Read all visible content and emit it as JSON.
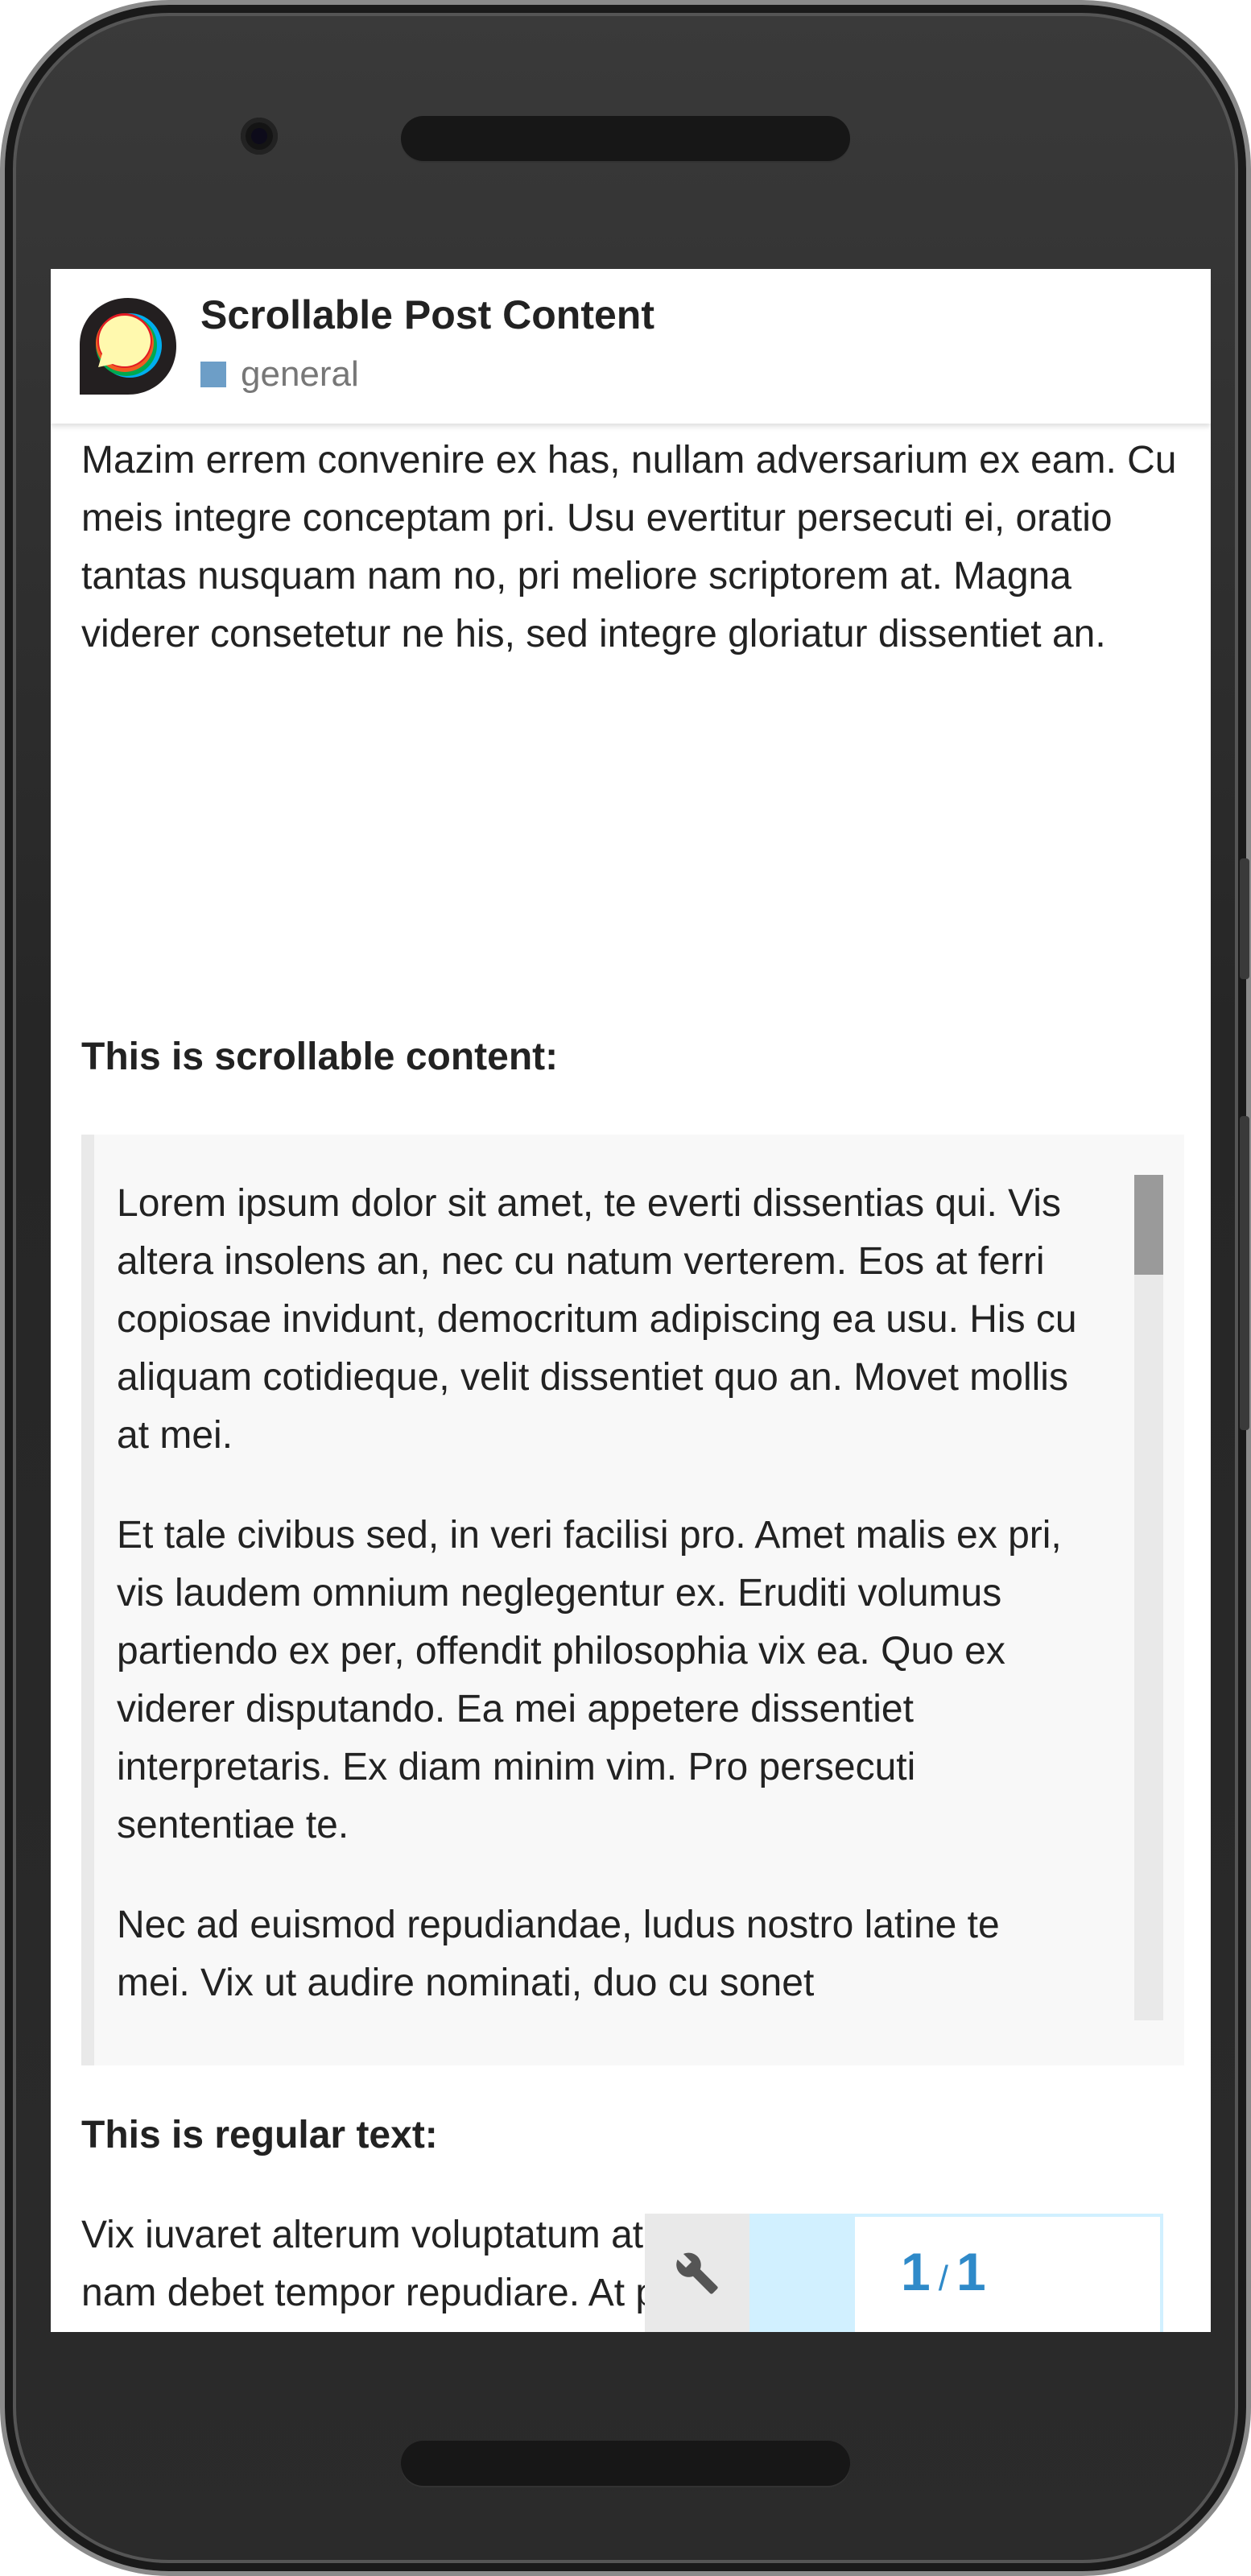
{
  "header": {
    "title": "Scrollable Post Content",
    "category": "general",
    "category_color": "#6d9ec7"
  },
  "post": {
    "intro": "Mazim errem convenire ex has, nullam adversarium ex eam. Cu meis integre conceptam pri. Usu evertitur persecuti ei, oratio tantas nusquam nam no, pri meliore scriptorem at. Magna viderer consetetur ne his, sed integre gloriatur dissentiet an.",
    "scrollable_heading": "This is scrollable content:",
    "scrollable_paragraphs": [
      "Lorem ipsum dolor sit amet, te everti dissentias qui. Vis altera insolens an, nec cu natum verterem. Eos at ferri copiosae invidunt, democritum adipiscing ea usu. His cu aliquam cotidieque, velit dissentiet quo an. Movet mollis at mei.",
      "Et tale civibus sed, in veri facilisi pro. Amet malis ex pri, vis laudem omnium neglegentur ex. Eruditi volumus partiendo ex per, offendit philosophia vix ea. Quo ex viderer disputando. Ea mei appetere dissentiet interpretaris. Ex diam minim vim. Pro persecuti sententiae te.",
      "Nec ad euismod repudiandae, ludus nostro latine te mei. Vix ut audire nominati, duo cu sonet"
    ],
    "regular_heading": "This is regular text:",
    "regular_text": "Vix iuvaret alterum voluptatum at, enim patrioque sea ad, ei nam debet tempor repudiare. At principes definiebas pro. Vel et aeterno appetere officiis, ad cum reque omnium. Cu his posse sonet. Sed ei constituto interpretaris, ei has nulla primis menandri. Tincidunt intellegebat ei vim. Est tibique"
  },
  "timeline": {
    "current": "1",
    "separator": "/",
    "total": "1",
    "wrench_icon": "wrench-icon",
    "accent_color": "#2f8ac9"
  }
}
